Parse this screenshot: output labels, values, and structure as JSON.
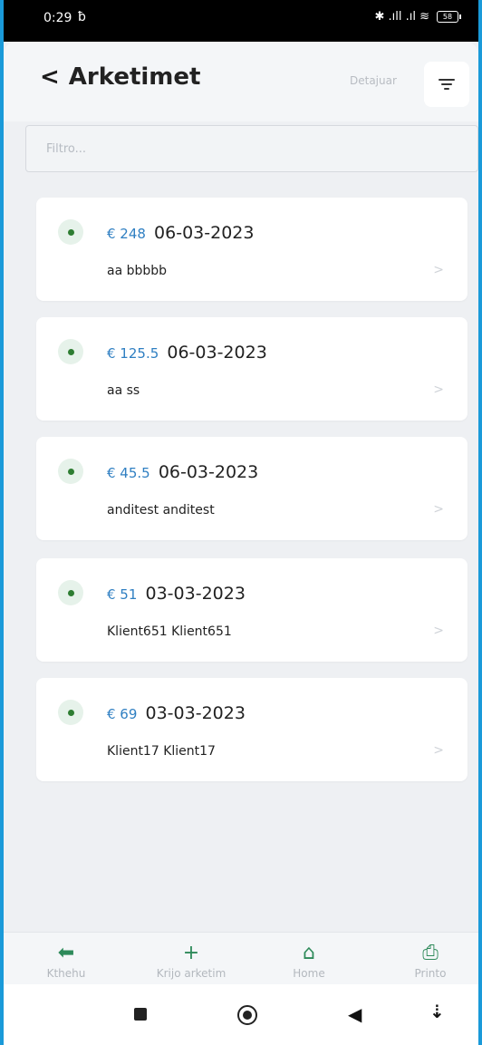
{
  "status": {
    "time": "0:29",
    "notif_icon": "ƀ",
    "icons": "✱ .ıll .ıl ≋",
    "battery": "58"
  },
  "header": {
    "back_icon": "<",
    "title": "Arketimet",
    "details": "Detajuar"
  },
  "search": {
    "placeholder": "Filtro..."
  },
  "items": [
    {
      "amount": "€ 248",
      "date": "06-03-2023",
      "client": "aa bbbbb"
    },
    {
      "amount": "€ 125.5",
      "date": "06-03-2023",
      "client": "aa ss"
    },
    {
      "amount": "€ 45.5",
      "date": "06-03-2023",
      "client": "anditest anditest"
    },
    {
      "amount": "€ 51",
      "date": "03-03-2023",
      "client": "Klient651 Klient651"
    },
    {
      "amount": "€ 69",
      "date": "03-03-2023",
      "client": "Klient17 Klient17"
    }
  ],
  "nav": [
    {
      "icon": "arrow-left-icon",
      "glyph": "⬅",
      "label": "Kthehu"
    },
    {
      "icon": "plus-icon",
      "glyph": "+",
      "label": "Krijo arketim"
    },
    {
      "icon": "home-icon",
      "glyph": "⌂",
      "label": "Home"
    },
    {
      "icon": "printer-icon",
      "glyph": "⎙",
      "label": "Printo"
    }
  ],
  "colors": {
    "accent": "#2e8a5a",
    "amount": "#2f7fc2",
    "status_dot": "#2e7d32"
  }
}
